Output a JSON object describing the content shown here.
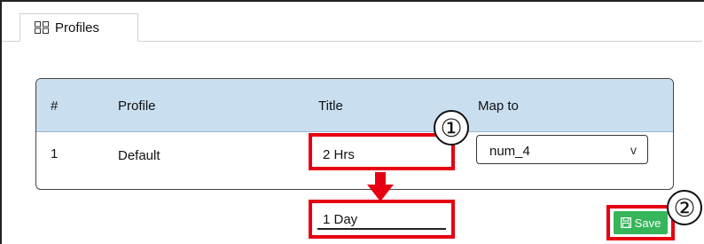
{
  "tabs": [
    {
      "label": "Profiles",
      "icon": "grid-icon"
    }
  ],
  "table": {
    "headers": [
      "#",
      "Profile",
      "Title",
      "Map to"
    ],
    "rows": [
      {
        "index": "1",
        "profile": "Default",
        "title": "2 Hrs",
        "map_to": "num_4"
      }
    ]
  },
  "new_title_value": "1 Day",
  "map_to_chevron": "v",
  "save_label": "Save",
  "callouts": [
    "①",
    "②"
  ],
  "colors": {
    "header_bg": "#c9dff0",
    "highlight": "#e60012",
    "save_bg": "#36b55a"
  }
}
